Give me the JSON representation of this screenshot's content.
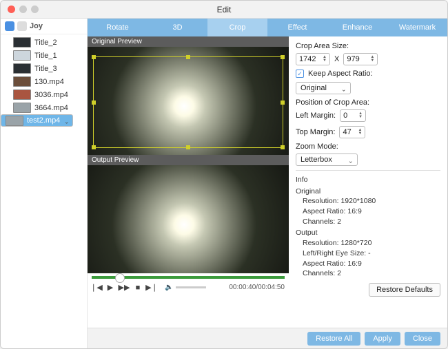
{
  "window": {
    "title": "Edit"
  },
  "sidebar": {
    "root": "Joy",
    "items": [
      {
        "label": "Title_2"
      },
      {
        "label": "Title_1"
      },
      {
        "label": "Title_3"
      },
      {
        "label": "130.mp4"
      },
      {
        "label": "3036.mp4"
      },
      {
        "label": "3664.mp4"
      },
      {
        "label": "test2.mp4"
      }
    ]
  },
  "tabs": {
    "items": [
      "Rotate",
      "3D",
      "Crop",
      "Effect",
      "Enhance",
      "Watermark"
    ],
    "active": "Crop"
  },
  "preview": {
    "original_title": "Original Preview",
    "output_title": "Output Preview",
    "time": "00:00:40/00:04:50"
  },
  "panel": {
    "crop_size_label": "Crop Area Size:",
    "crop_w": "1742",
    "crop_x": "X",
    "crop_h": "979",
    "keep_ratio_label": "Keep Aspect Ratio:",
    "ratio_select": "Original",
    "pos_label": "Position of Crop Area:",
    "left_label": "Left Margin:",
    "left_val": "0",
    "top_label": "Top Margin:",
    "top_val": "47",
    "zoom_label": "Zoom Mode:",
    "zoom_select": "Letterbox",
    "info_head": "Info",
    "orig_head": "Original",
    "orig_res": "Resolution: 1920*1080",
    "orig_ar": "Aspect Ratio: 16:9",
    "orig_ch": "Channels: 2",
    "out_head": "Output",
    "out_res": "Resolution: 1280*720",
    "out_eye": "Left/Right Eye Size: -",
    "out_ar": "Aspect Ratio: 16:9",
    "out_ch": "Channels: 2",
    "restore_defaults": "Restore Defaults"
  },
  "footer": {
    "restore_all": "Restore All",
    "apply": "Apply",
    "close": "Close"
  }
}
